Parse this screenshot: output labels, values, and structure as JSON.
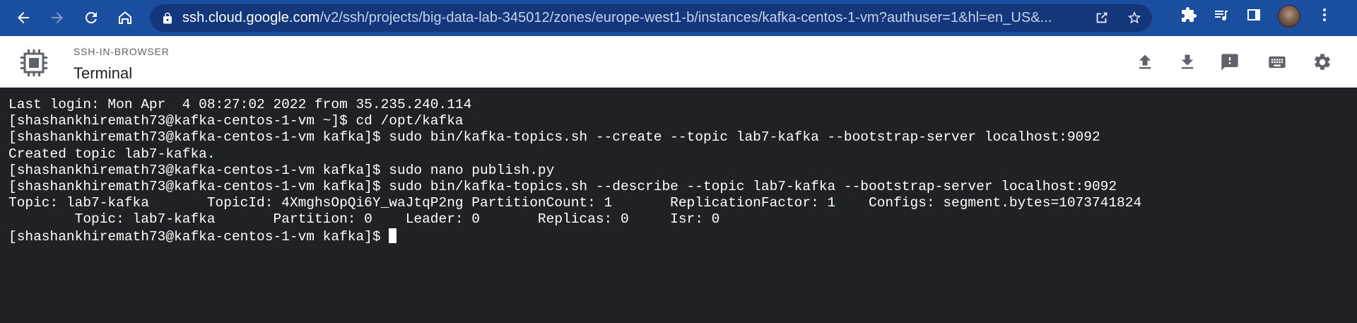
{
  "browser": {
    "url_host": "ssh.cloud.google.com",
    "url_path": "/v2/ssh/projects/big-data-lab-345012/zones/europe-west1-b/instances/kafka-centos-1-vm?authuser=1&hl=en_US&...",
    "icons": [
      "back-icon",
      "forward-icon",
      "reload-icon",
      "home-icon",
      "lock-icon",
      "share-icon",
      "star-icon",
      "extensions-icon",
      "media-icon",
      "sidepanel-icon",
      "profile-avatar",
      "more-icon"
    ]
  },
  "header": {
    "subtitle": "SSH-IN-BROWSER",
    "title": "Terminal",
    "actions": [
      "upload-icon",
      "download-icon",
      "feedback-icon",
      "keyboard-icon",
      "settings-icon"
    ]
  },
  "terminal": {
    "lines": [
      "Last login: Mon Apr  4 08:27:02 2022 from 35.235.240.114",
      "[shashankhiremath73@kafka-centos-1-vm ~]$ cd /opt/kafka",
      "[shashankhiremath73@kafka-centos-1-vm kafka]$ sudo bin/kafka-topics.sh --create --topic lab7-kafka --bootstrap-server localhost:9092",
      "Created topic lab7-kafka.",
      "[shashankhiremath73@kafka-centos-1-vm kafka]$ sudo nano publish.py",
      "[shashankhiremath73@kafka-centos-1-vm kafka]$ sudo bin/kafka-topics.sh --describe --topic lab7-kafka --bootstrap-server localhost:9092",
      "Topic: lab7-kafka       TopicId: 4XmghsOpQi6Y_waJtqP2ng PartitionCount: 1       ReplicationFactor: 1    Configs: segment.bytes=1073741824",
      "        Topic: lab7-kafka       Partition: 0    Leader: 0       Replicas: 0     Isr: 0"
    ],
    "prompt": "[shashankhiremath73@kafka-centos-1-vm kafka]$ "
  }
}
